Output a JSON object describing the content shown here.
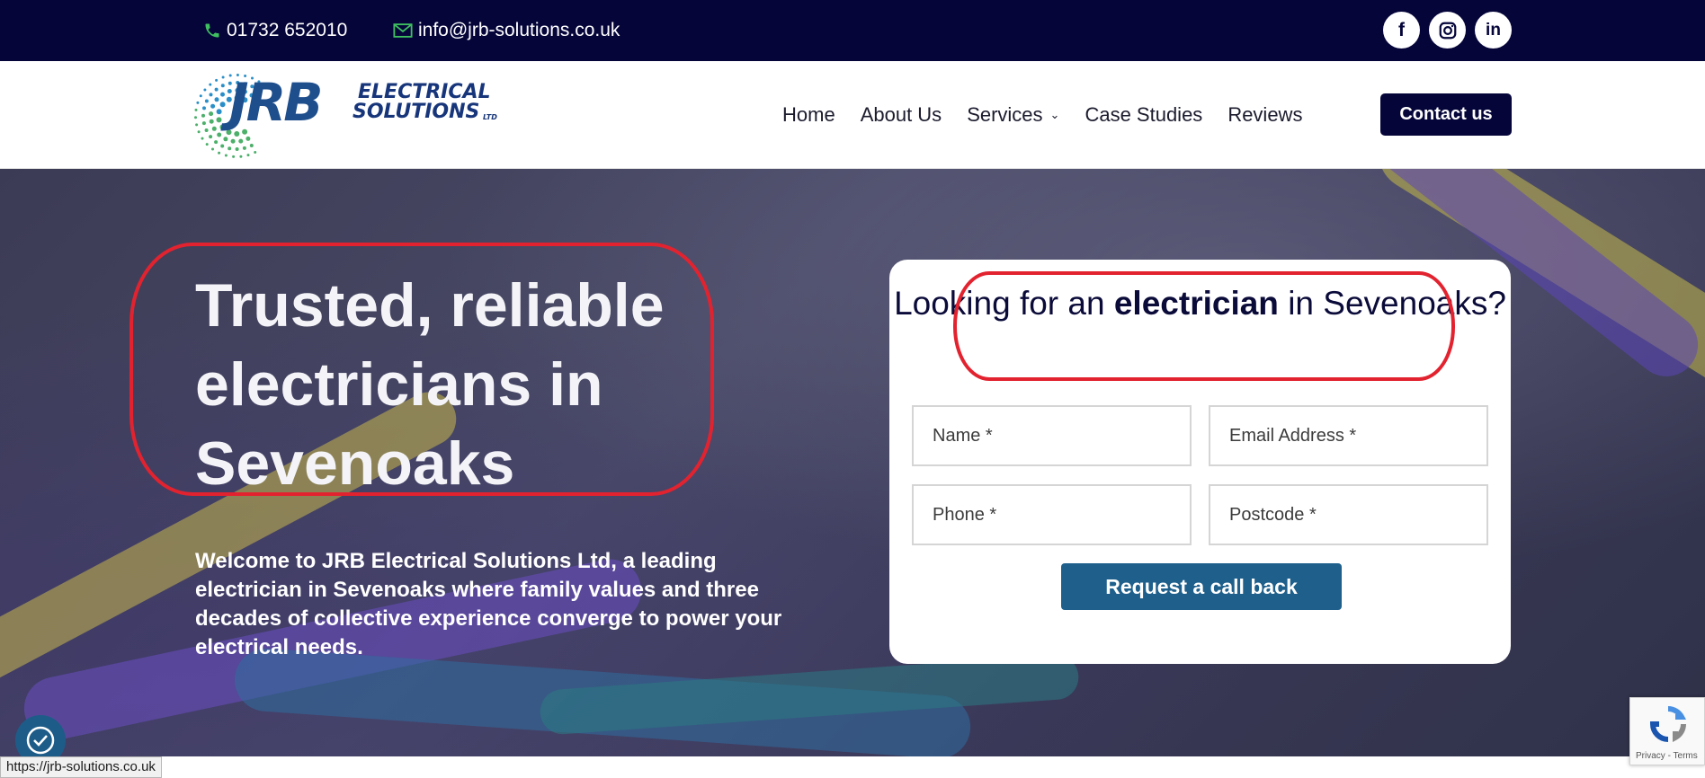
{
  "topbar": {
    "phone": "01732 652010",
    "email": "info@jrb-solutions.co.uk",
    "socials": {
      "facebook": "f",
      "instagram": "instagram-icon",
      "linkedin": "in"
    }
  },
  "header": {
    "logo": {
      "jrb": "JRB",
      "electrical": "ELECTRICAL",
      "solutions": "SOLUTIONS",
      "ltd": "LTD"
    },
    "nav": {
      "home": "Home",
      "about": "About Us",
      "services": "Services",
      "case_studies": "Case Studies",
      "reviews": "Reviews"
    },
    "contact_button": "Contact us"
  },
  "hero": {
    "title": "Trusted, reliable electricians in Sevenoaks",
    "description": "Welcome to JRB Electrical Solutions Ltd, a leading electrician in Sevenoaks where family values and three decades of collective experience converge to power your electrical needs.",
    "form": {
      "heading_pre": "Looking for an ",
      "heading_bold": "electrician",
      "heading_post": " in Sevenoaks?",
      "fields": {
        "name": "Name *",
        "email": "Email Address *",
        "phone": "Phone *",
        "postcode": "Postcode *"
      },
      "submit": "Request a call back"
    }
  },
  "status_bar": {
    "url": "https://jrb-solutions.co.uk"
  },
  "recaptcha": {
    "privacy": "Privacy",
    "separator": " - ",
    "terms": "Terms"
  },
  "colors": {
    "navy": "#05053a",
    "accent_blue": "#1e5f8c",
    "highlight_red": "#e2232f"
  }
}
